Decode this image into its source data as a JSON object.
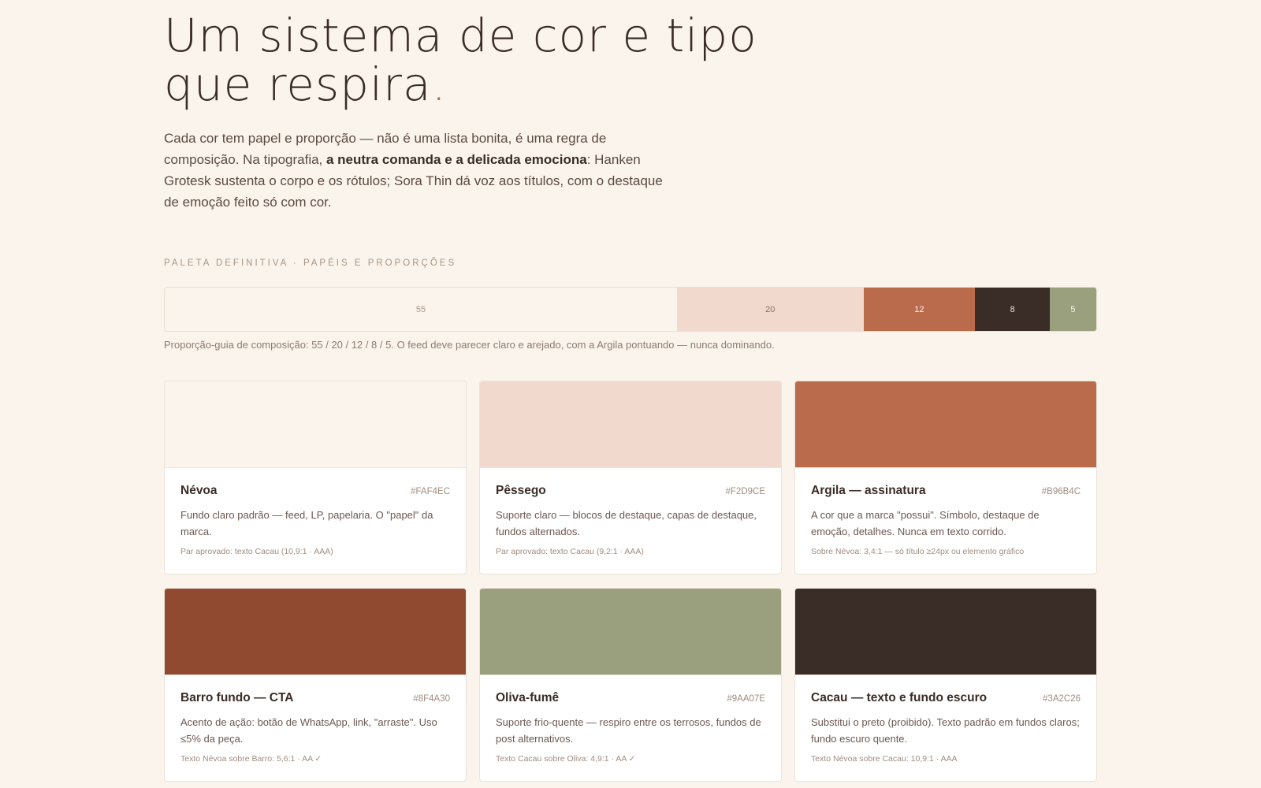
{
  "hero": {
    "title_line1": "Um sistema de cor e tipo",
    "title_line2": "que respira",
    "title_dot": ".",
    "lead_part1": "Cada cor tem papel e proporção — não é uma lista bonita, é uma regra de composição. Na tipografia, ",
    "lead_bold": "a neutra comanda e a delicada emociona",
    "lead_part2": ": Hanken Grotesk sustenta o corpo e os rótulos; Sora Thin dá voz aos títulos, com o destaque de emoção feito só com cor."
  },
  "palette": {
    "section_label": "Paleta definitiva · papéis e proporções",
    "ratio_segments": [
      {
        "value": "55",
        "proportion": 55,
        "color": "#FAF4EC",
        "text_color": "#A89585"
      },
      {
        "value": "20",
        "proportion": 20,
        "color": "#F2D9CE",
        "text_color": "#8F6A5A"
      },
      {
        "value": "12",
        "proportion": 12,
        "color": "#B96B4C",
        "text_color": "#FAF4EC"
      },
      {
        "value": "8",
        "proportion": 8,
        "color": "#3A2C26",
        "text_color": "#E8DDD2"
      },
      {
        "value": "5",
        "proportion": 5,
        "color": "#9AA07E",
        "text_color": "#FAF4EC"
      }
    ],
    "ratio_note": "Proporção-guia de composição: 55 / 20 / 12 / 8 / 5. O feed deve parecer claro e arejado, com a Argila pontuando — nunca dominando.",
    "cards": [
      {
        "name": "Névoa",
        "hex": "#FAF4EC",
        "color": "#FAF4EC",
        "description": "Fundo claro padrão — feed, LP, papelaria. O \"papel\" da marca.",
        "pair": "Par aprovado: texto Cacau (10,9:1 · AAA)"
      },
      {
        "name": "Pêssego",
        "hex": "#F2D9CE",
        "color": "#F2D9CE",
        "description": "Suporte claro — blocos de destaque, capas de destaque, fundos alternados.",
        "pair": "Par aprovado: texto Cacau (9,2:1 · AAA)"
      },
      {
        "name": "Argila — assinatura",
        "hex": "#B96B4C",
        "color": "#B96B4C",
        "description": "A cor que a marca \"possui\". Símbolo, destaque de emoção, detalhes. Nunca em texto corrido.",
        "pair": "Sobre Névoa: 3,4:1 — só título ≥24px ou elemento gráfico"
      },
      {
        "name": "Barro fundo — CTA",
        "hex": "#8F4A30",
        "color": "#8F4A30",
        "description": "Acento de ação: botão de WhatsApp, link, \"arraste\". Uso ≤5% da peça.",
        "pair": "Texto Névoa sobre Barro: 5,6:1 · AA ✓"
      },
      {
        "name": "Oliva-fumê",
        "hex": "#9AA07E",
        "color": "#9AA07E",
        "description": "Suporte frio-quente — respiro entre os terrosos, fundos de post alternativos.",
        "pair": "Texto Cacau sobre Oliva: 4,9:1 · AA ✓"
      },
      {
        "name": "Cacau — texto e fundo escuro",
        "hex": "#3A2C26",
        "color": "#3A2C26",
        "description": "Substitui o preto (proibido). Texto padrão em fundos claros; fundo escuro quente.",
        "pair": "Texto Névoa sobre Cacau: 10,9:1 · AAA"
      }
    ]
  }
}
